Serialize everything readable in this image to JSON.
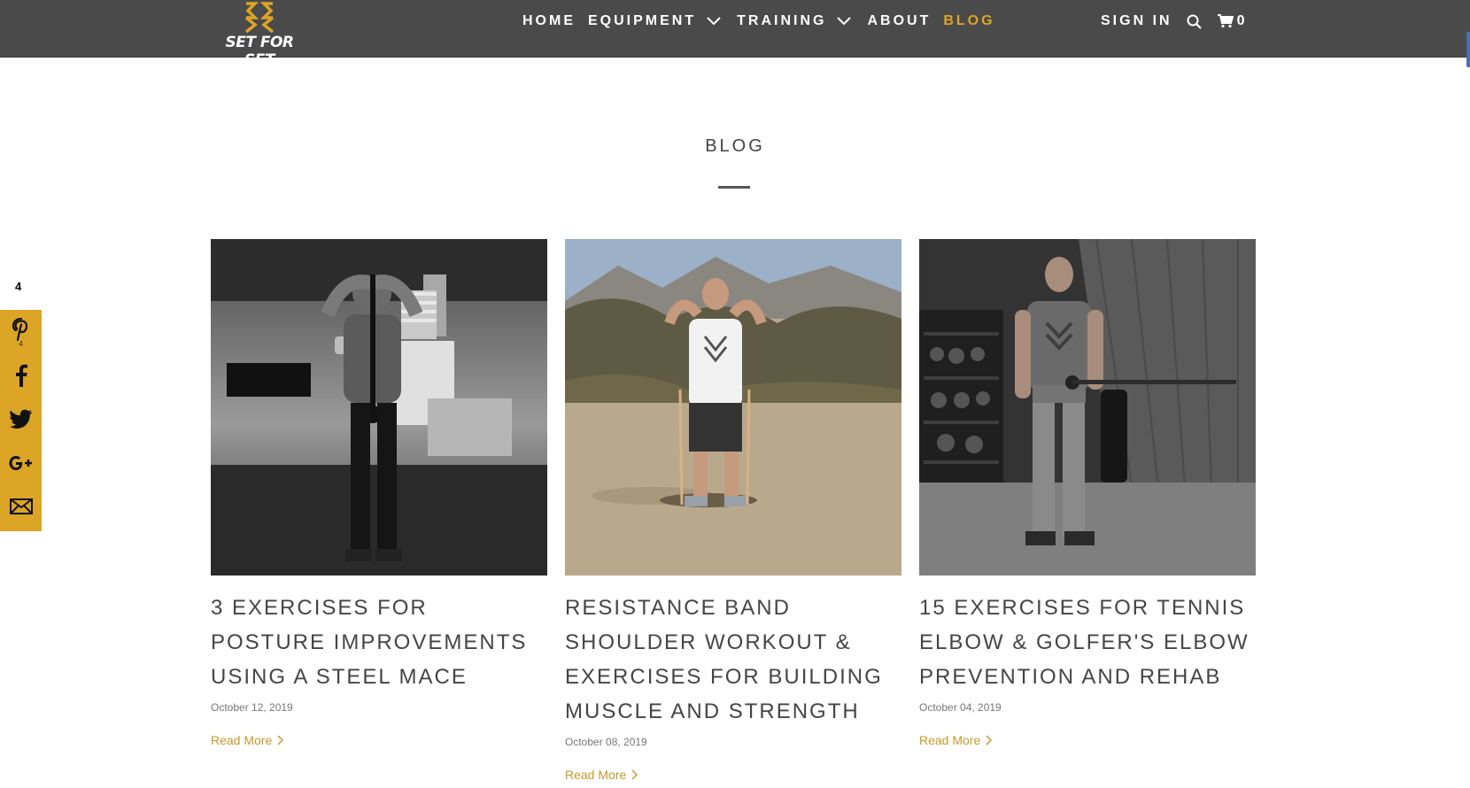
{
  "brand": {
    "logo_text": "SET FOR SET",
    "accent": "#dca525",
    "header_bg": "#4a4a4a"
  },
  "nav": {
    "items": [
      {
        "label": "HOME"
      },
      {
        "label": "EQUIPMENT"
      },
      {
        "label": "TRAINING"
      },
      {
        "label": "ABOUT"
      },
      {
        "label": "BLOG"
      }
    ],
    "sign_in": "SIGN IN",
    "cart_count": "0"
  },
  "page": {
    "title": "BLOG"
  },
  "social": {
    "share_count": "4",
    "pinterest_count": "4",
    "icons": [
      "pinterest-icon",
      "facebook-icon",
      "twitter-icon",
      "google-plus-icon",
      "email-icon"
    ]
  },
  "posts": [
    {
      "title": "3 EXERCISES FOR POSTURE IMPROVEMENTS USING A STEEL MACE",
      "date": "October 12, 2019",
      "read_more": "Read More"
    },
    {
      "title": "RESISTANCE BAND SHOULDER WORKOUT & EXERCISES FOR BUILDING MUSCLE AND STRENGTH",
      "date": "October 08, 2019",
      "read_more": "Read More"
    },
    {
      "title": "15 EXERCISES FOR TENNIS ELBOW & GOLFER'S ELBOW PREVENTION AND REHAB",
      "date": "October 04, 2019",
      "read_more": "Read More"
    }
  ]
}
